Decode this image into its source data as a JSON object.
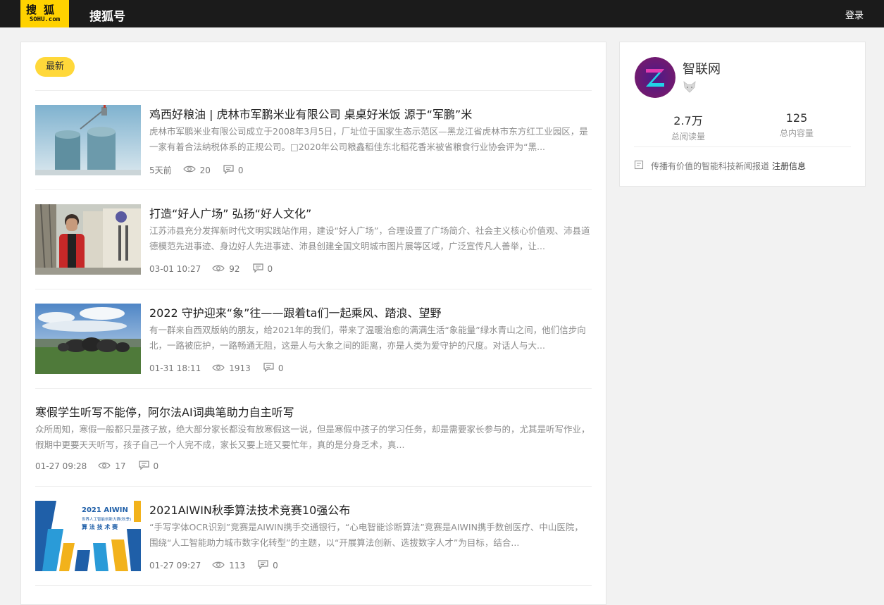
{
  "header": {
    "logo_top": "搜狐",
    "logo_bottom": "SOHU.com",
    "brand": "搜狐号",
    "login": "登录"
  },
  "main": {
    "tab": "最新",
    "articles": [
      {
        "title": "鸡西好粮油 | 虎林市军鹏米业有限公司 桌桌好米饭 源于“军鹏”米",
        "desc": "虎林市军鹏米业有限公司成立于2008年3月5日，厂址位于国家生态示范区—黑龙江省虎林市东方红工业园区，是一家有着合法纳税体系的正规公司。□2020年公司粮鑫稻佳东北稻花香米被省粮食行业协会评为“黑...",
        "time": "5天前",
        "views": "20",
        "comments": "0"
      },
      {
        "title": "打造“好人广场” 弘扬“好人文化”",
        "desc": "江苏沛县充分发挥新时代文明实践站作用，建设“好人广场”，合理设置了广场简介、社会主义核心价值观、沛县道德模范先进事迹、身边好人先进事迹、沛县创建全国文明城市图片展等区域，广泛宣传凡人善举，让...",
        "time": "03-01 10:27",
        "views": "92",
        "comments": "0"
      },
      {
        "title": "2022 守护迎来“象”往——跟着ta们一起乘风、踏浪、望野",
        "desc": "有一群来自西双版纳的朋友，给2021年的我们，带来了温暖治愈的满满生活“象能量”绿水青山之间，他们信步向北，一路被庇护，一路畅通无阻，这是人与大象之间的距离，亦是人类为爱守护的尺度。对话人与大...",
        "time": "01-31 18:11",
        "views": "1913",
        "comments": "0"
      },
      {
        "title": "寒假学生听写不能停，阿尔法AI词典笔助力自主听写",
        "desc": "众所周知，寒假一般都只是孩子放，绝大部分家长都没有放寒假这一说，但是寒假中孩子的学习任务，却是需要家长参与的，尤其是听写作业，假期中更要天天听写，孩子自己一个人完不成，家长又要上班又要忙年，真的是分身乏术，真...",
        "time": "01-27 09:28",
        "views": "17",
        "comments": "0"
      },
      {
        "title": "2021AIWIN秋季算法技术竞赛10强公布",
        "desc": "“手写字体OCR识别”竞赛是AIWIN携手交通银行，“心电智能诊断算法”竞赛是AIWIN携手数创医疗、中山医院，围绕“人工智能助力城市数字化转型”的主题，以“开展算法创新、选拔数字人才”为目标，结合...",
        "time": "01-27 09:27",
        "views": "113",
        "comments": "0",
        "thumb_text_1": "2021 AIWIN",
        "thumb_text_2": "世界人工智能创新大赛(秋季)",
        "thumb_text_3": "算 法 技 术 赛"
      }
    ]
  },
  "profile": {
    "name": "智联网",
    "reads_value": "2.7万",
    "reads_label": "总阅读量",
    "content_value": "125",
    "content_label": "总内容量",
    "intro": "传播有价值的智能科技新闻报道",
    "register": "注册信息"
  }
}
